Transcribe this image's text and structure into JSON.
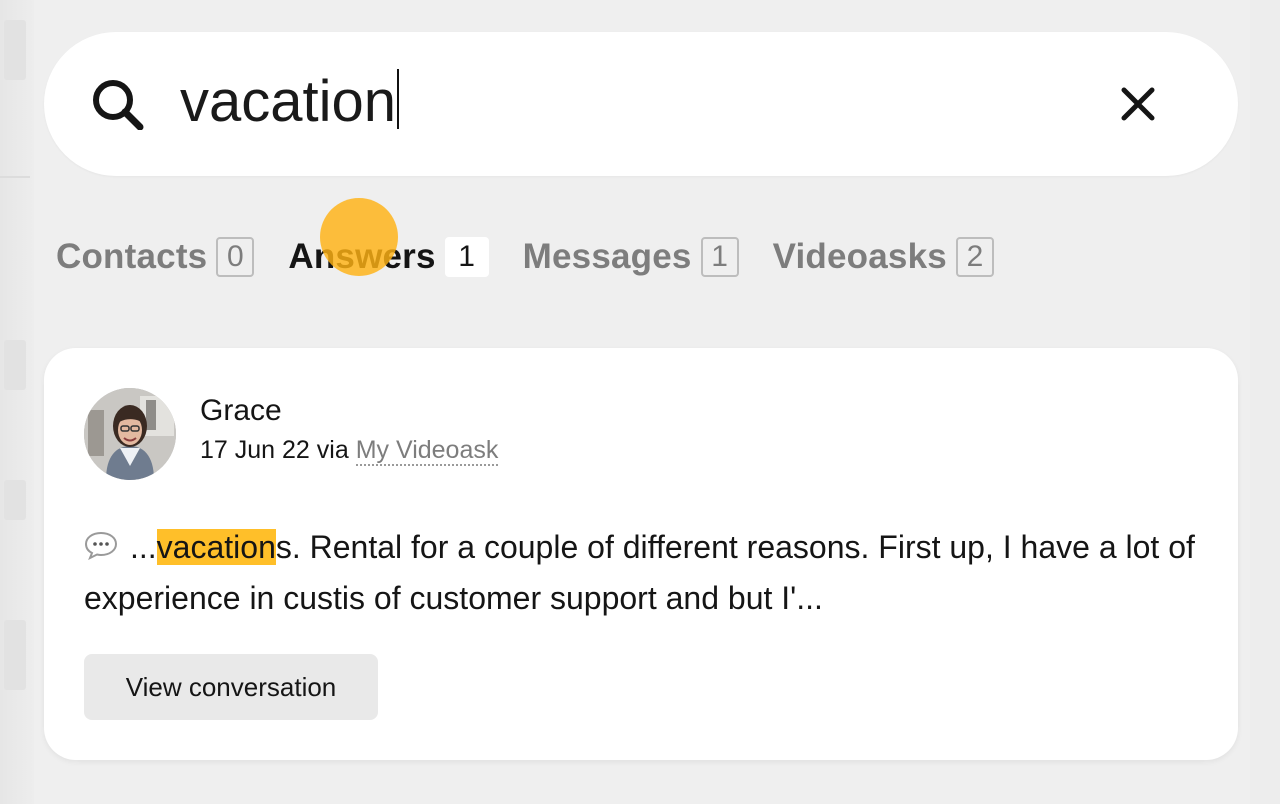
{
  "search": {
    "value": "vacation",
    "icon": "search-icon",
    "clear_icon": "close-icon"
  },
  "tabs": [
    {
      "label": "Contacts",
      "count": "0",
      "active": false
    },
    {
      "label": "Answers",
      "count": "1",
      "active": true
    },
    {
      "label": "Messages",
      "count": "1",
      "active": false
    },
    {
      "label": "Videoasks",
      "count": "2",
      "active": false
    }
  ],
  "result": {
    "name": "Grace",
    "date": "17 Jun 22",
    "via_word": "via",
    "source": "My Videoask",
    "snippet_prefix": "...",
    "snippet_highlight": "vacation",
    "snippet_rest": "s. Rental for a couple of different reasons. First up, I have a lot of experience in custis of customer support and but I'...",
    "button_label": "View conversation",
    "icon": "speech-bubble-icon"
  },
  "colors": {
    "accent": "#ffbf29",
    "background": "#efefef",
    "text": "#151515",
    "muted": "#7d7d7d"
  }
}
